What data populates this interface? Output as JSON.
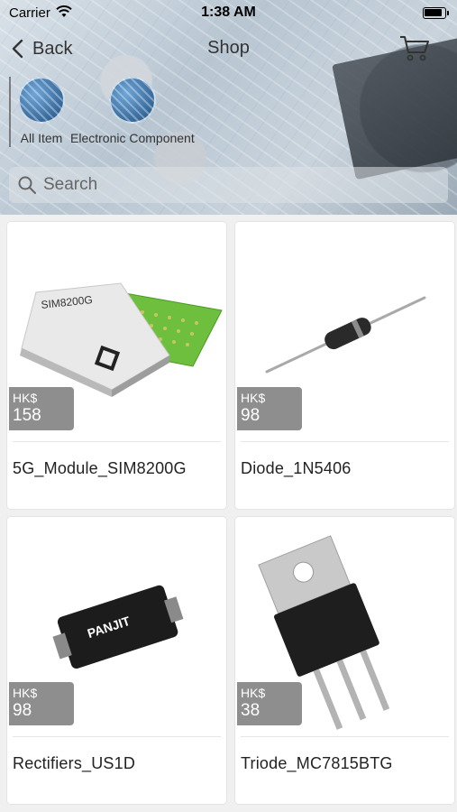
{
  "status_bar": {
    "carrier": "Carrier",
    "time": "1:38 AM"
  },
  "nav": {
    "back_label": "Back",
    "title": "Shop"
  },
  "categories": [
    {
      "label": "All Item"
    },
    {
      "label": "Electronic Component"
    }
  ],
  "search": {
    "placeholder": "Search"
  },
  "products": [
    {
      "name": "5G_Module_SIM8200G",
      "currency": "HK$",
      "price": "158",
      "image": "5g-module-chip-image"
    },
    {
      "name": "Diode_1N5406",
      "currency": "HK$",
      "price": "98",
      "image": "diode-image"
    },
    {
      "name": "Rectifiers_US1D",
      "currency": "HK$",
      "price": "98",
      "image": "rectifier-image"
    },
    {
      "name": "Triode_MC7815BTG",
      "currency": "HK$",
      "price": "38",
      "image": "triode-image"
    }
  ]
}
